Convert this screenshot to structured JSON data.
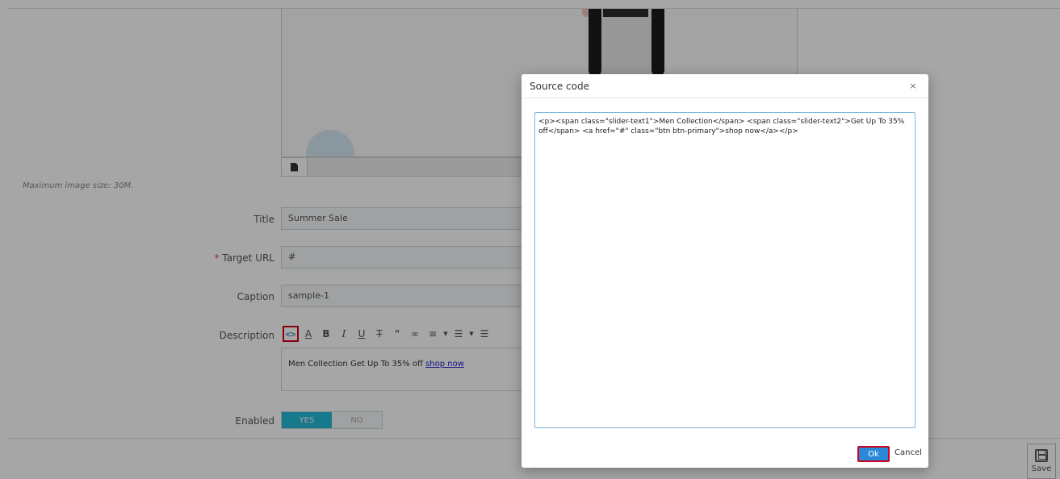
{
  "upload": {
    "max_size_text": "Maximum image size: 30M."
  },
  "form": {
    "title_label": "Title",
    "title_value": "Summer Sale",
    "target_url_star": "*",
    "target_url_label": "Target URL",
    "target_url_value": "#",
    "caption_label": "Caption",
    "caption_value": "sample-1",
    "description_label": "Description",
    "description_text": "Men Collection Get Up To 35% off",
    "description_link": "shop now",
    "enabled_label": "Enabled",
    "enabled_yes": "YES",
    "enabled_no": "NO"
  },
  "toolbar": {
    "icons": [
      "source-code-icon",
      "font-color-icon",
      "bold-icon",
      "italic-icon",
      "underline-icon",
      "strikethrough-icon",
      "blockquote-icon",
      "link-icon",
      "align-icon",
      "bullet-list-icon",
      "numbered-list-icon"
    ]
  },
  "save": {
    "label": "Save"
  },
  "modal": {
    "title": "Source code",
    "close": "×",
    "source": "<p><span class=\"slider-text1\">Men Collection</span> <span class=\"slider-text2\">Get Up To 35% off</span> <a href=\"#\" class=\"btn btn-primary\">shop now</a></p>",
    "ok_label": "Ok",
    "cancel_label": "Cancel"
  },
  "colors": {
    "accent": "#25b9d7",
    "ok_button": "#2b88d8",
    "highlight": "#d0021b"
  }
}
